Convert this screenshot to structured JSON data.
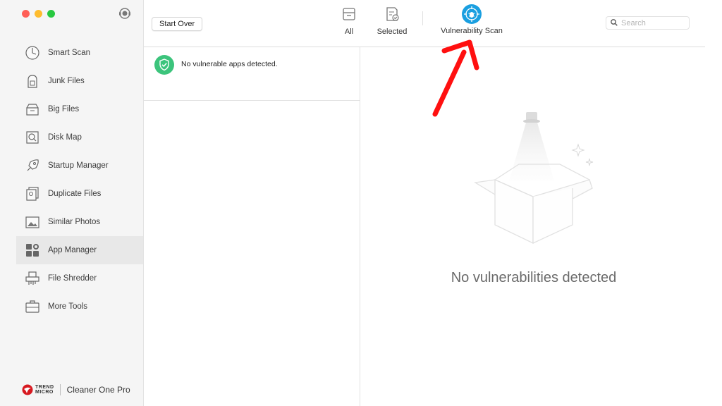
{
  "sidebar": {
    "items": [
      {
        "label": "Smart Scan",
        "icon": "smart-scan-icon"
      },
      {
        "label": "Junk Files",
        "icon": "junk-files-icon"
      },
      {
        "label": "Big Files",
        "icon": "big-files-icon"
      },
      {
        "label": "Disk Map",
        "icon": "disk-map-icon"
      },
      {
        "label": "Startup Manager",
        "icon": "startup-manager-icon"
      },
      {
        "label": "Duplicate Files",
        "icon": "duplicate-files-icon"
      },
      {
        "label": "Similar Photos",
        "icon": "similar-photos-icon"
      },
      {
        "label": "App Manager",
        "icon": "app-manager-icon",
        "active": true
      },
      {
        "label": "File Shredder",
        "icon": "file-shredder-icon"
      },
      {
        "label": "More Tools",
        "icon": "more-tools-icon"
      }
    ],
    "brand": {
      "logo_text": "TREND MICRO",
      "product": "Cleaner One Pro"
    }
  },
  "toolbar": {
    "start_over_label": "Start Over",
    "tabs": [
      {
        "label": "All",
        "icon": "archive-icon"
      },
      {
        "label": "Selected",
        "icon": "selected-list-icon"
      },
      {
        "label": "Vulnerability Scan",
        "icon": "vulnerability-scan-icon",
        "active": true
      }
    ],
    "search": {
      "placeholder": "Search",
      "value": ""
    }
  },
  "left_panel": {
    "status_text": "No vulnerable apps detected.",
    "status_icon": "shield-check-icon"
  },
  "right_panel": {
    "empty_text": "No vulnerabilities detected",
    "illustration": "empty-box-icon"
  },
  "colors": {
    "accent": "#1a9fe0",
    "success": "#3cc47c",
    "annotation": "#ff1010"
  }
}
